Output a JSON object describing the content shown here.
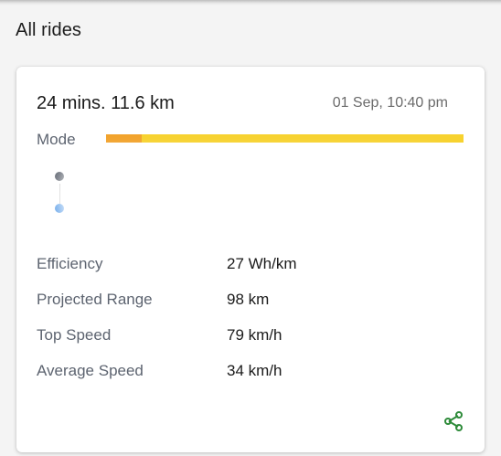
{
  "header": {
    "title": "All rides"
  },
  "ride": {
    "summary": "24 mins. 11.6 km",
    "datetime": "01 Sep, 10:40 pm",
    "mode_label": "Mode",
    "mode_segments": [
      {
        "fraction": 0.1,
        "color": "#f2a32c"
      },
      {
        "fraction": 0.9,
        "color": "#f7d22f"
      }
    ],
    "route": {
      "start_dot_color": "#5f6570",
      "end_dot_color": "#5b9ee8"
    },
    "stats": [
      {
        "label": "Efficiency",
        "value": "27 Wh/km"
      },
      {
        "label": "Projected Range",
        "value": "98 km"
      },
      {
        "label": "Top Speed",
        "value": "79 km/h"
      },
      {
        "label": "Average Speed",
        "value": "34 km/h"
      }
    ],
    "share_icon": "share-icon",
    "accent_color": "#2e8b3a"
  }
}
